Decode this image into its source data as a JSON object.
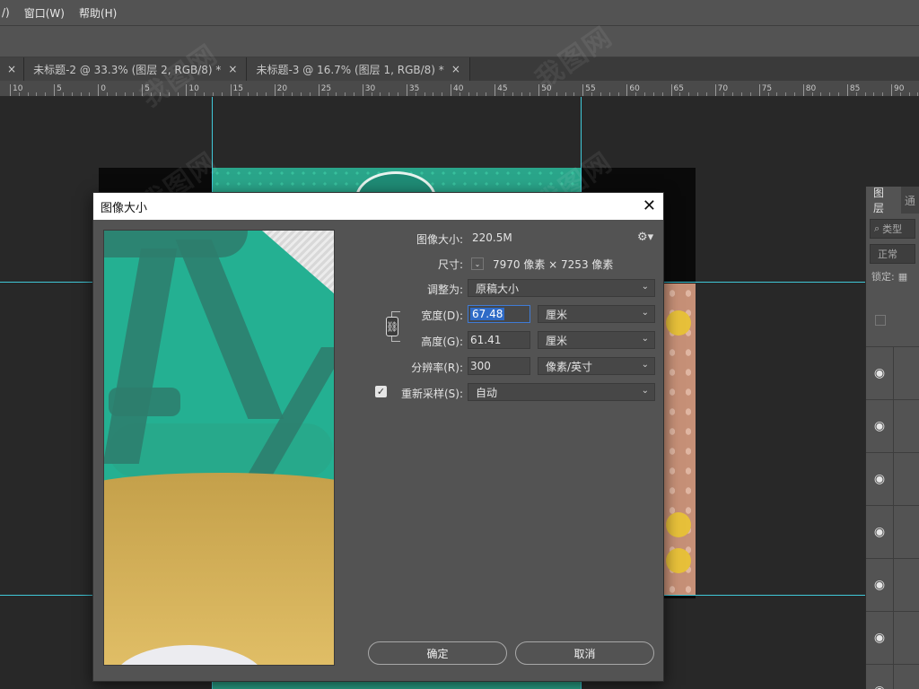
{
  "menubar": {
    "items": [
      "/)",
      "窗口(W)",
      "帮助(H)"
    ]
  },
  "tabs": [
    {
      "label": "",
      "close": "×"
    },
    {
      "label": "未标题-2 @ 33.3% (图层 2, RGB/8) *",
      "close": "×"
    },
    {
      "label": "未标题-3 @ 16.7% (图层 1, RGB/8) *",
      "close": "×"
    }
  ],
  "ruler": {
    "labels": [
      "10",
      "5",
      "0",
      "5",
      "10",
      "15",
      "20",
      "25",
      "30",
      "35",
      "40",
      "45",
      "50",
      "55",
      "60",
      "65",
      "70",
      "75",
      "80",
      "85",
      "90"
    ]
  },
  "watermark": {
    "text": "我图网"
  },
  "layers_panel": {
    "tab_layers": "图层",
    "tab_next": "通",
    "search_placeholder": "类型",
    "blend_mode": "正常",
    "lock_label": "锁定:",
    "eye_glyph": "👁"
  },
  "dialog": {
    "title": "图像大小",
    "close": "✕",
    "image_size_label": "图像大小:",
    "image_size_value": "220.5M",
    "dimensions_label": "尺寸:",
    "dimensions_value": "7970 像素 × 7253 像素",
    "fit_to_label": "调整为:",
    "fit_to_value": "原稿大小",
    "width_label": "宽度(D):",
    "width_value": "67.48",
    "width_unit": "厘米",
    "height_label": "高度(G):",
    "height_value": "61.41",
    "height_unit": "厘米",
    "resolution_label": "分辨率(R):",
    "resolution_value": "300",
    "resolution_unit": "像素/英寸",
    "resample_label": "重新采样(S):",
    "resample_checked": true,
    "resample_value": "自动",
    "ok_label": "确定",
    "cancel_label": "取消"
  }
}
